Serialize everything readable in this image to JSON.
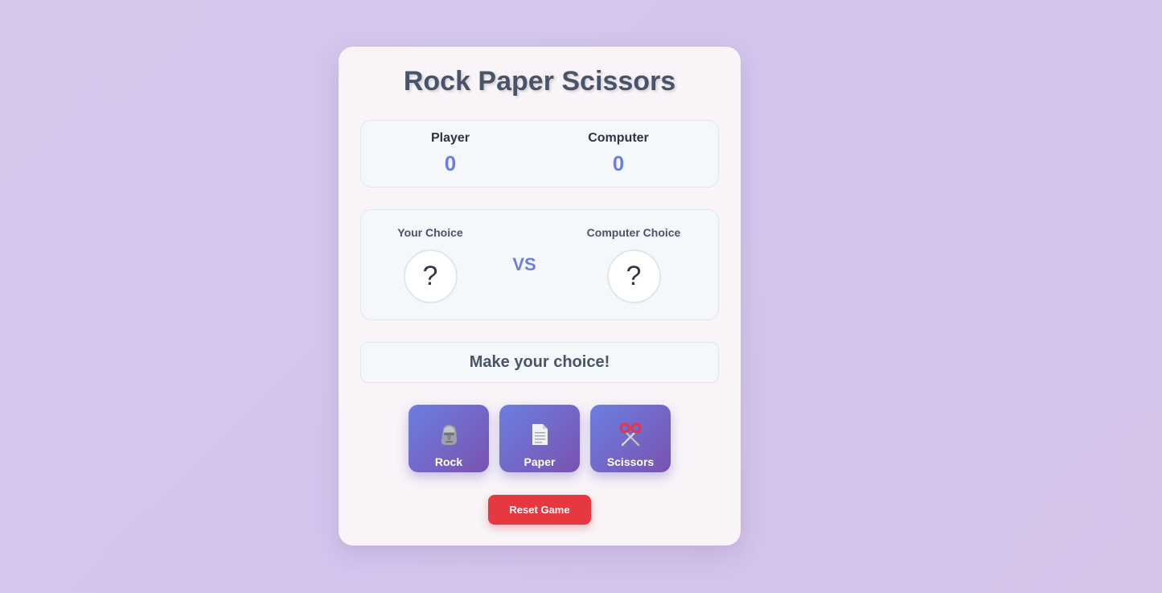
{
  "title": "Rock Paper Scissors",
  "score": {
    "player_label": "Player",
    "player_value": "0",
    "computer_label": "Computer",
    "computer_value": "0"
  },
  "choices": {
    "your_label": "Your Choice",
    "your_value": "?",
    "vs": "VS",
    "computer_label": "Computer Choice",
    "computer_value": "?"
  },
  "result": "Make your choice!",
  "moves": [
    {
      "label": "Rock",
      "icon": "rock-icon"
    },
    {
      "label": "Paper",
      "icon": "paper-icon"
    },
    {
      "label": "Scissors",
      "icon": "scissors-icon"
    }
  ],
  "reset_label": "Reset Game",
  "colors": {
    "accent": "#6b7fe0",
    "button_gradient_end": "#7a52b0",
    "reset": "#e5393f",
    "heading": "#4a5468"
  }
}
